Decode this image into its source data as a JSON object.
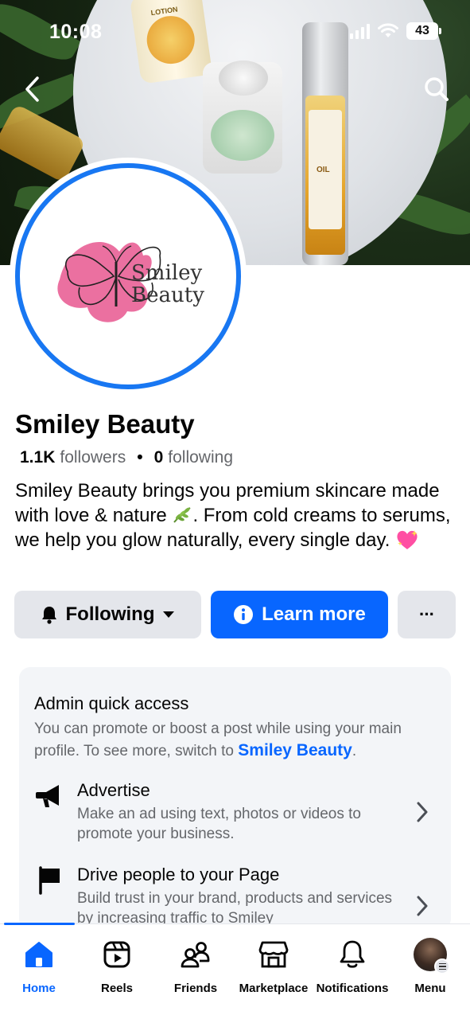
{
  "status_bar": {
    "time": "10:08",
    "battery": "43"
  },
  "cover": {
    "product_labels": [
      "LOTION",
      "OIL"
    ]
  },
  "avatar": {
    "logo_line1": "Smiley",
    "logo_line2": "Beauty"
  },
  "profile": {
    "name": "Smiley Beauty",
    "followers_count": "1.1K",
    "followers_label": "followers",
    "following_count": "0",
    "following_label": "following",
    "bio_part1": "Smiley Beauty brings you premium skincare made with love & nature ",
    "bio_part2": ". From cold creams to serums, we help you glow naturally, every single day. "
  },
  "actions": {
    "following_label": "Following",
    "learn_more_label": "Learn more",
    "more_label": "···"
  },
  "admin_card": {
    "title": "Admin quick access",
    "desc_prefix": "You can promote or boost a post while using your main profile. To see more, switch to ",
    "desc_link": "Smiley Beauty",
    "desc_suffix": ".",
    "items": [
      {
        "title": "Advertise",
        "desc": "Make an ad using text, photos or videos to promote your business."
      },
      {
        "title": "Drive people to your Page",
        "desc": "Build trust in your brand, products and services by increasing traffic to Smiley"
      }
    ]
  },
  "nav": {
    "items": [
      {
        "label": "Home"
      },
      {
        "label": "Reels"
      },
      {
        "label": "Friends"
      },
      {
        "label": "Marketplace"
      },
      {
        "label": "Notifications"
      },
      {
        "label": "Menu"
      }
    ]
  },
  "colors": {
    "accent": "#0866ff",
    "ring": "#1877f2",
    "secondary_text": "#65676b",
    "button_gray": "#e4e6eb",
    "card_bg": "#f3f5f8"
  }
}
